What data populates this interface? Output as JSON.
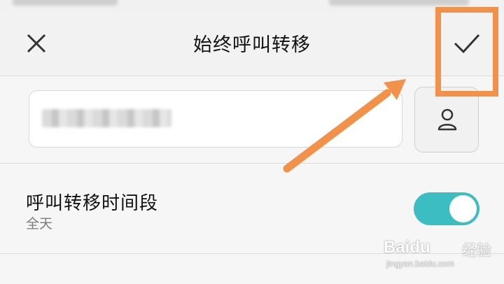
{
  "header": {
    "title": "始终呼叫转移",
    "close_icon": "close-icon",
    "confirm_icon": "check-icon"
  },
  "number_input": {
    "value_masked": true,
    "contact_icon": "person-icon"
  },
  "forward_period": {
    "label": "呼叫转移时间段",
    "value": "全天",
    "toggle_on": true,
    "toggle_color": "#3bbdc2"
  },
  "annotation": {
    "color": "#f29149",
    "shape": "box-and-arrow",
    "target": "confirm-button"
  },
  "watermark": {
    "brand": "Baidu",
    "cn": "经验",
    "url": "jingyan.baidu.com"
  }
}
